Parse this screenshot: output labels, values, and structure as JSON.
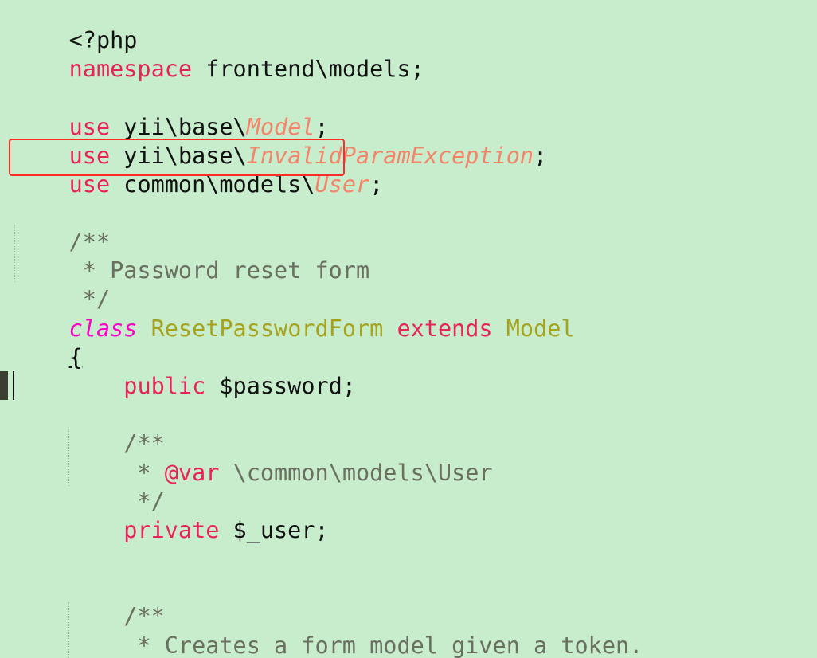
{
  "editor": {
    "background": "#c7edcc",
    "colors": {
      "keyword": "#e8235a",
      "keyword_italic": "#ff00c8",
      "type_italic": "#f4856b",
      "class_name": "#a6a21b",
      "comment": "#6a6f5f",
      "text": "#111111",
      "highlight_box": "#ff2a2a"
    },
    "lines": [
      {
        "tokens": [
          {
            "t": "<?php"
          }
        ]
      },
      {
        "tokens": [
          {
            "t": "namespace"
          },
          {
            "t": " frontend\\models;"
          }
        ]
      },
      {
        "tokens": [
          {
            "t": ""
          }
        ]
      },
      {
        "tokens": [
          {
            "t": "use"
          },
          {
            "t": " yii\\base\\"
          },
          {
            "t": "Model"
          },
          {
            "t": ";"
          }
        ]
      },
      {
        "tokens": [
          {
            "t": "use"
          },
          {
            "t": " yii\\base\\"
          },
          {
            "t": "InvalidParamException"
          },
          {
            "t": ";"
          }
        ]
      },
      {
        "tokens": [
          {
            "t": "use"
          },
          {
            "t": " common\\models\\"
          },
          {
            "t": "User"
          },
          {
            "t": ";"
          }
        ]
      },
      {
        "tokens": [
          {
            "t": ""
          }
        ]
      },
      {
        "tokens": [
          {
            "t": "/**"
          }
        ]
      },
      {
        "tokens": [
          {
            "t": " * Password reset form"
          }
        ]
      },
      {
        "tokens": [
          {
            "t": " */"
          }
        ]
      },
      {
        "tokens": [
          {
            "t": "class"
          },
          {
            "t": " "
          },
          {
            "t": "ResetPasswordForm"
          },
          {
            "t": " "
          },
          {
            "t": "extends"
          },
          {
            "t": " "
          },
          {
            "t": "Model"
          }
        ]
      },
      {
        "tokens": [
          {
            "t": "{"
          }
        ]
      },
      {
        "tokens": [
          {
            "t": "    "
          },
          {
            "t": "public"
          },
          {
            "t": " $password;"
          }
        ]
      },
      {
        "tokens": [
          {
            "t": ""
          }
        ]
      },
      {
        "tokens": [
          {
            "t": "    "
          },
          {
            "t": "/**"
          }
        ]
      },
      {
        "tokens": [
          {
            "t": "     * "
          },
          {
            "t": "@var"
          },
          {
            "t": " \\common\\models\\User"
          }
        ]
      },
      {
        "tokens": [
          {
            "t": "     */"
          }
        ]
      },
      {
        "tokens": [
          {
            "t": "    "
          },
          {
            "t": "private"
          },
          {
            "t": " $_user;"
          }
        ]
      },
      {
        "tokens": [
          {
            "t": ""
          }
        ]
      },
      {
        "tokens": [
          {
            "t": ""
          }
        ]
      },
      {
        "tokens": [
          {
            "t": "    "
          },
          {
            "t": "/**"
          }
        ]
      },
      {
        "tokens": [
          {
            "t": "     * Creates a form model given a token."
          }
        ]
      },
      {
        "tokens": [
          {
            "t": "     *"
          }
        ]
      }
    ]
  }
}
